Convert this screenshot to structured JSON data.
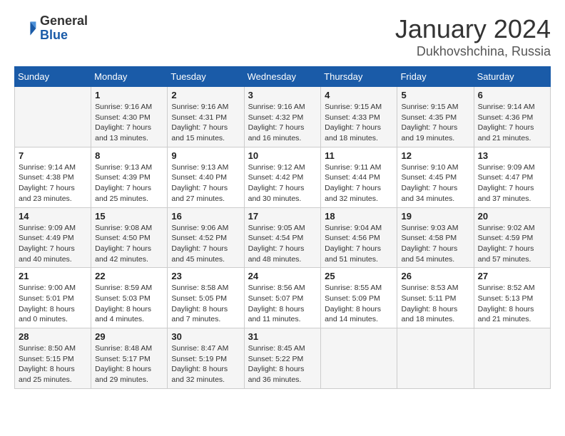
{
  "header": {
    "logo_general": "General",
    "logo_blue": "Blue",
    "title": "January 2024",
    "location": "Dukhovshchina, Russia"
  },
  "days_of_week": [
    "Sunday",
    "Monday",
    "Tuesday",
    "Wednesday",
    "Thursday",
    "Friday",
    "Saturday"
  ],
  "weeks": [
    [
      {
        "day": "",
        "sunrise": "",
        "sunset": "",
        "daylight": ""
      },
      {
        "day": "1",
        "sunrise": "Sunrise: 9:16 AM",
        "sunset": "Sunset: 4:30 PM",
        "daylight": "Daylight: 7 hours and 13 minutes."
      },
      {
        "day": "2",
        "sunrise": "Sunrise: 9:16 AM",
        "sunset": "Sunset: 4:31 PM",
        "daylight": "Daylight: 7 hours and 15 minutes."
      },
      {
        "day": "3",
        "sunrise": "Sunrise: 9:16 AM",
        "sunset": "Sunset: 4:32 PM",
        "daylight": "Daylight: 7 hours and 16 minutes."
      },
      {
        "day": "4",
        "sunrise": "Sunrise: 9:15 AM",
        "sunset": "Sunset: 4:33 PM",
        "daylight": "Daylight: 7 hours and 18 minutes."
      },
      {
        "day": "5",
        "sunrise": "Sunrise: 9:15 AM",
        "sunset": "Sunset: 4:35 PM",
        "daylight": "Daylight: 7 hours and 19 minutes."
      },
      {
        "day": "6",
        "sunrise": "Sunrise: 9:14 AM",
        "sunset": "Sunset: 4:36 PM",
        "daylight": "Daylight: 7 hours and 21 minutes."
      }
    ],
    [
      {
        "day": "7",
        "sunrise": "Sunrise: 9:14 AM",
        "sunset": "Sunset: 4:38 PM",
        "daylight": "Daylight: 7 hours and 23 minutes."
      },
      {
        "day": "8",
        "sunrise": "Sunrise: 9:13 AM",
        "sunset": "Sunset: 4:39 PM",
        "daylight": "Daylight: 7 hours and 25 minutes."
      },
      {
        "day": "9",
        "sunrise": "Sunrise: 9:13 AM",
        "sunset": "Sunset: 4:40 PM",
        "daylight": "Daylight: 7 hours and 27 minutes."
      },
      {
        "day": "10",
        "sunrise": "Sunrise: 9:12 AM",
        "sunset": "Sunset: 4:42 PM",
        "daylight": "Daylight: 7 hours and 30 minutes."
      },
      {
        "day": "11",
        "sunrise": "Sunrise: 9:11 AM",
        "sunset": "Sunset: 4:44 PM",
        "daylight": "Daylight: 7 hours and 32 minutes."
      },
      {
        "day": "12",
        "sunrise": "Sunrise: 9:10 AM",
        "sunset": "Sunset: 4:45 PM",
        "daylight": "Daylight: 7 hours and 34 minutes."
      },
      {
        "day": "13",
        "sunrise": "Sunrise: 9:09 AM",
        "sunset": "Sunset: 4:47 PM",
        "daylight": "Daylight: 7 hours and 37 minutes."
      }
    ],
    [
      {
        "day": "14",
        "sunrise": "Sunrise: 9:09 AM",
        "sunset": "Sunset: 4:49 PM",
        "daylight": "Daylight: 7 hours and 40 minutes."
      },
      {
        "day": "15",
        "sunrise": "Sunrise: 9:08 AM",
        "sunset": "Sunset: 4:50 PM",
        "daylight": "Daylight: 7 hours and 42 minutes."
      },
      {
        "day": "16",
        "sunrise": "Sunrise: 9:06 AM",
        "sunset": "Sunset: 4:52 PM",
        "daylight": "Daylight: 7 hours and 45 minutes."
      },
      {
        "day": "17",
        "sunrise": "Sunrise: 9:05 AM",
        "sunset": "Sunset: 4:54 PM",
        "daylight": "Daylight: 7 hours and 48 minutes."
      },
      {
        "day": "18",
        "sunrise": "Sunrise: 9:04 AM",
        "sunset": "Sunset: 4:56 PM",
        "daylight": "Daylight: 7 hours and 51 minutes."
      },
      {
        "day": "19",
        "sunrise": "Sunrise: 9:03 AM",
        "sunset": "Sunset: 4:58 PM",
        "daylight": "Daylight: 7 hours and 54 minutes."
      },
      {
        "day": "20",
        "sunrise": "Sunrise: 9:02 AM",
        "sunset": "Sunset: 4:59 PM",
        "daylight": "Daylight: 7 hours and 57 minutes."
      }
    ],
    [
      {
        "day": "21",
        "sunrise": "Sunrise: 9:00 AM",
        "sunset": "Sunset: 5:01 PM",
        "daylight": "Daylight: 8 hours and 0 minutes."
      },
      {
        "day": "22",
        "sunrise": "Sunrise: 8:59 AM",
        "sunset": "Sunset: 5:03 PM",
        "daylight": "Daylight: 8 hours and 4 minutes."
      },
      {
        "day": "23",
        "sunrise": "Sunrise: 8:58 AM",
        "sunset": "Sunset: 5:05 PM",
        "daylight": "Daylight: 8 hours and 7 minutes."
      },
      {
        "day": "24",
        "sunrise": "Sunrise: 8:56 AM",
        "sunset": "Sunset: 5:07 PM",
        "daylight": "Daylight: 8 hours and 11 minutes."
      },
      {
        "day": "25",
        "sunrise": "Sunrise: 8:55 AM",
        "sunset": "Sunset: 5:09 PM",
        "daylight": "Daylight: 8 hours and 14 minutes."
      },
      {
        "day": "26",
        "sunrise": "Sunrise: 8:53 AM",
        "sunset": "Sunset: 5:11 PM",
        "daylight": "Daylight: 8 hours and 18 minutes."
      },
      {
        "day": "27",
        "sunrise": "Sunrise: 8:52 AM",
        "sunset": "Sunset: 5:13 PM",
        "daylight": "Daylight: 8 hours and 21 minutes."
      }
    ],
    [
      {
        "day": "28",
        "sunrise": "Sunrise: 8:50 AM",
        "sunset": "Sunset: 5:15 PM",
        "daylight": "Daylight: 8 hours and 25 minutes."
      },
      {
        "day": "29",
        "sunrise": "Sunrise: 8:48 AM",
        "sunset": "Sunset: 5:17 PM",
        "daylight": "Daylight: 8 hours and 29 minutes."
      },
      {
        "day": "30",
        "sunrise": "Sunrise: 8:47 AM",
        "sunset": "Sunset: 5:19 PM",
        "daylight": "Daylight: 8 hours and 32 minutes."
      },
      {
        "day": "31",
        "sunrise": "Sunrise: 8:45 AM",
        "sunset": "Sunset: 5:22 PM",
        "daylight": "Daylight: 8 hours and 36 minutes."
      },
      {
        "day": "",
        "sunrise": "",
        "sunset": "",
        "daylight": ""
      },
      {
        "day": "",
        "sunrise": "",
        "sunset": "",
        "daylight": ""
      },
      {
        "day": "",
        "sunrise": "",
        "sunset": "",
        "daylight": ""
      }
    ]
  ]
}
